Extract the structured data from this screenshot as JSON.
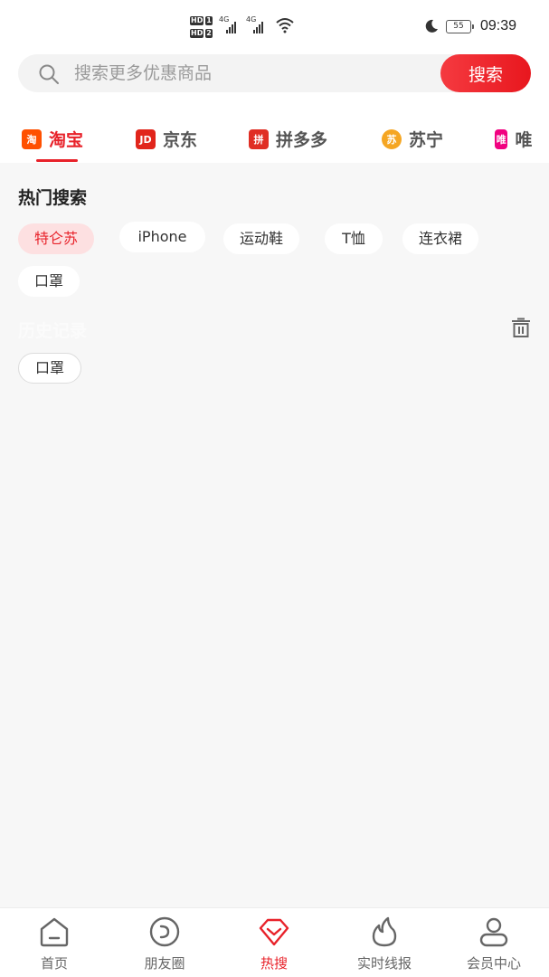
{
  "status_bar": {
    "time": "09:39",
    "battery": "55",
    "sim1_badge": "HD",
    "sim1_num": "1",
    "sim2_badge": "HD",
    "sim2_num": "2",
    "network1": "4G",
    "network2": "4G"
  },
  "search": {
    "placeholder": "搜索更多优惠商品",
    "button_label": "搜索"
  },
  "platform_tabs": [
    {
      "label": "淘宝",
      "logo_text": "淘",
      "logo_color": "#ff5000",
      "active": true
    },
    {
      "label": "京东",
      "logo_text": "JD",
      "logo_color": "#e1251b",
      "active": false
    },
    {
      "label": "拼多多",
      "logo_text": "拼",
      "logo_color": "#e02e24",
      "active": false
    },
    {
      "label": "苏宁",
      "logo_text": "苏",
      "logo_color": "#f5a623",
      "active": false
    },
    {
      "label": "唯品会",
      "logo_text": "唯",
      "logo_color": "#f10180",
      "active": false
    }
  ],
  "hot_search": {
    "title": "热门搜索",
    "items": [
      "特仑苏",
      "iPhone",
      "运动鞋",
      "T恤",
      "连衣裙",
      "口罩"
    ]
  },
  "history": {
    "title": "历史记录",
    "items": [
      "口罩"
    ]
  },
  "bottom_nav": [
    {
      "label": "首页",
      "icon": "home-icon",
      "active": false
    },
    {
      "label": "朋友圈",
      "icon": "moments-icon",
      "active": false
    },
    {
      "label": "热搜",
      "icon": "hot-search-icon",
      "active": true
    },
    {
      "label": "实时线报",
      "icon": "flame-icon",
      "active": false
    },
    {
      "label": "会员中心",
      "icon": "user-icon",
      "active": false
    }
  ],
  "colors": {
    "accent": "#e8222a",
    "page_bg": "#f7f7f7",
    "chip_active_bg": "#fde0e1"
  }
}
